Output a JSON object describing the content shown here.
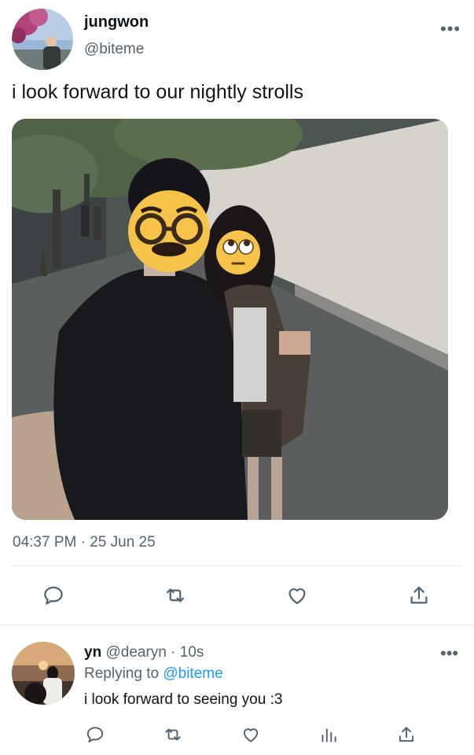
{
  "tweet": {
    "display_name": "jungwon",
    "handle": "@biteme",
    "more": "•••",
    "text": "i look forward to our nightly strolls",
    "timestamp": "04:37 PM · 25 Jun 25",
    "actions": [
      "reply-icon",
      "retweet-icon",
      "like-icon",
      "share-icon"
    ]
  },
  "reply": {
    "display_name": "yn",
    "meta": "@dearyn · 10s",
    "replying_prefix": "Replying to ",
    "replying_handle": "@biteme",
    "text": "i look forward to seeing you :3",
    "more": "•••",
    "actions": [
      "reply-icon",
      "retweet-icon",
      "like-icon",
      "analytics-icon",
      "share-icon"
    ]
  },
  "colors": {
    "text_primary": "#0f1419",
    "text_secondary": "#536471",
    "link": "#1d9bf0",
    "divider": "#e3e7ea"
  }
}
